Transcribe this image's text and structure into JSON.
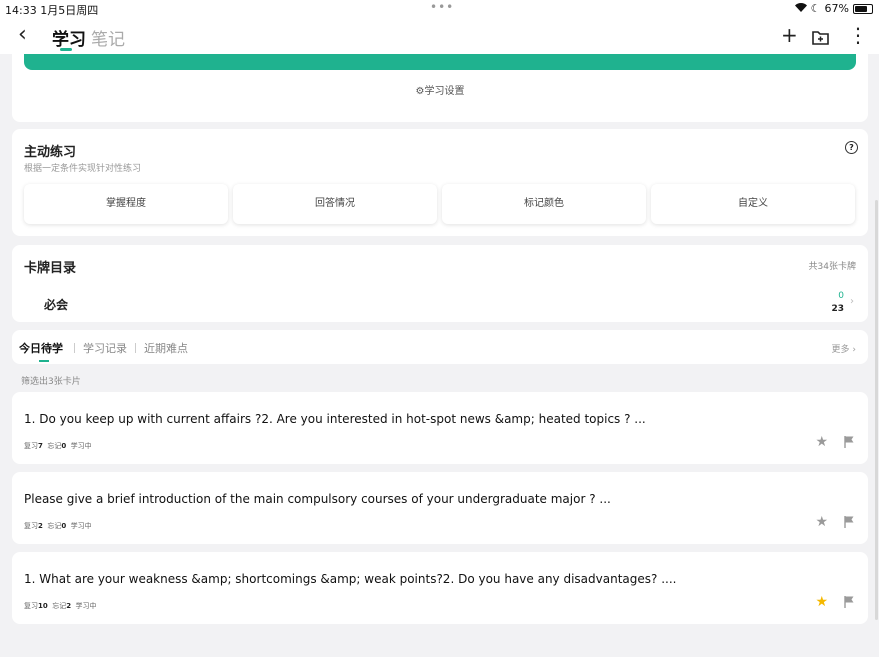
{
  "status": {
    "time": "14:33  1月5日周四",
    "dots": "•••",
    "battery": "67%"
  },
  "nav": {
    "back": "‹",
    "tab_active": "学习",
    "tab_inactive": "笔记",
    "add": "+",
    "folder": "⊞",
    "more": "⋮"
  },
  "settings": {
    "label": "⚙学习设置"
  },
  "practice": {
    "title": "主动练习",
    "subtitle": "根据一定条件实现针对性练习",
    "help": "?",
    "options": [
      "掌握程度",
      "回答情况",
      "标记颜色",
      "自定义"
    ]
  },
  "catalog": {
    "title": "卡牌目录",
    "count": "共34张卡牌",
    "deck": {
      "name": "必会",
      "new": "0",
      "due": "23"
    }
  },
  "tabs": {
    "today": "今日待学",
    "records": "学习记录",
    "difficult": "近期难点",
    "more": "更多 ›"
  },
  "filter": "筛选出3张卡片",
  "cards": [
    {
      "text": "1. Do you keep up with current affairs ?2. Are you interested in hot-spot news &amp; heated topics ? ...",
      "review_label": "复习",
      "review": "7",
      "forget_label": "忘记",
      "forget": "0",
      "status": "学习中",
      "starred": false
    },
    {
      "text": "Please give a brief introduction of the main compulsory courses of your undergraduate major ? ...",
      "review_label": "复习",
      "review": "2",
      "forget_label": "忘记",
      "forget": "0",
      "status": "学习中",
      "starred": false
    },
    {
      "text": "1. What are your weakness &amp; shortcomings &amp; weak points?2. Do you have any disadvantages? ....",
      "review_label": "复习",
      "review": "10",
      "forget_label": "忘记",
      "forget": "2",
      "status": "学习中",
      "starred": true
    }
  ],
  "colors": {
    "accent": "#1fb28f",
    "star_on": "#f5b800",
    "star_off": "#9a9a9a",
    "background": "#f2f2f4"
  }
}
